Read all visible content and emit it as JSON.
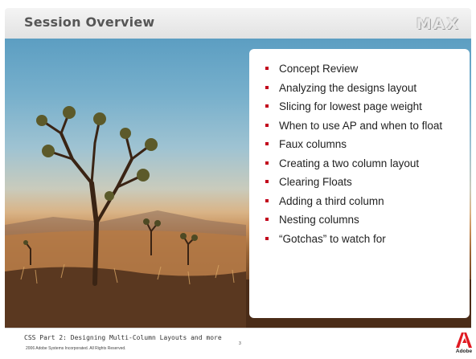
{
  "header": {
    "title": "Session Overview",
    "logo_text": "MAX"
  },
  "photo": {
    "subject": "joshua-tree-desert-photo"
  },
  "bullets": [
    "Concept Review",
    "Analyzing the designs layout",
    "Slicing for lowest page weight",
    "When to use AP and when to float",
    "Faux columns",
    "Creating a two column layout",
    "Clearing Floats",
    "Adding a third column",
    "Nesting columns",
    "“Gotchas” to watch for"
  ],
  "footer": {
    "title": "CSS Part 2: Designing Multi-Column Layouts and more",
    "copyright": "2006 Adobe Systems Incorporated. All Rights Reserved.",
    "page_number": "3",
    "brand": "Adobe"
  },
  "colors": {
    "bullet": "#c2001b",
    "title": "#565656",
    "adobe_red": "#e01a22"
  }
}
